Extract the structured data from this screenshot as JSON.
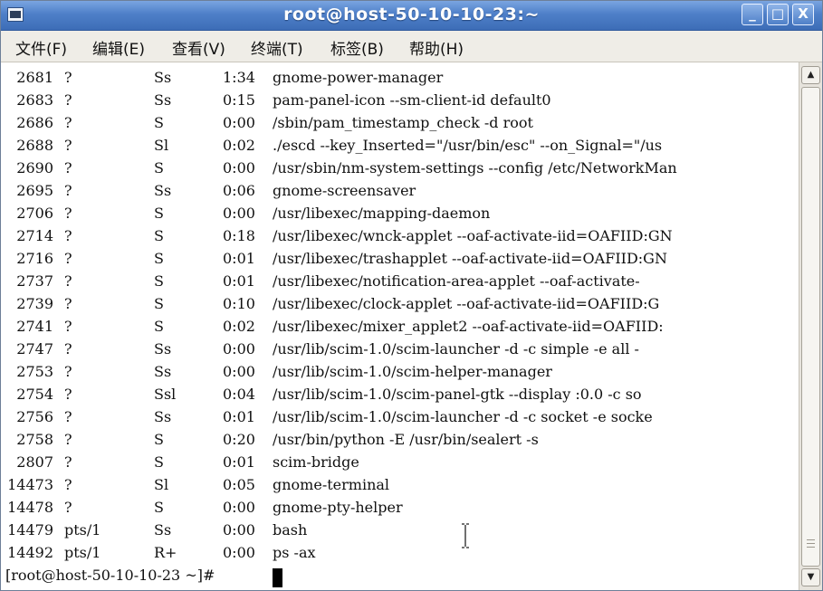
{
  "window": {
    "title": "root@host-50-10-10-23:~",
    "buttons": {
      "minimize": "_",
      "maximize": "□",
      "close": "X"
    }
  },
  "menu": [
    {
      "label": "文件(F)"
    },
    {
      "label": "编辑(E)"
    },
    {
      "label": "查看(V)"
    },
    {
      "label": "终端(T)"
    },
    {
      "label": "标签(B)"
    },
    {
      "label": "帮助(H)"
    }
  ],
  "processes": [
    {
      "pid": "2681",
      "tty": "?",
      "stat": "Ss",
      "time": "1:34",
      "cmd": "gnome-power-manager"
    },
    {
      "pid": "2683",
      "tty": "?",
      "stat": "Ss",
      "time": "0:15",
      "cmd": "pam-panel-icon --sm-client-id default0"
    },
    {
      "pid": "2686",
      "tty": "?",
      "stat": "S",
      "time": "0:00",
      "cmd": "/sbin/pam_timestamp_check -d root"
    },
    {
      "pid": "2688",
      "tty": "?",
      "stat": "Sl",
      "time": "0:02",
      "cmd": "./escd --key_Inserted=\"/usr/bin/esc\" --on_Signal=\"/us"
    },
    {
      "pid": "2690",
      "tty": "?",
      "stat": "S",
      "time": "0:00",
      "cmd": "/usr/sbin/nm-system-settings --config /etc/NetworkMan"
    },
    {
      "pid": "2695",
      "tty": "?",
      "stat": "Ss",
      "time": "0:06",
      "cmd": "gnome-screensaver"
    },
    {
      "pid": "2706",
      "tty": "?",
      "stat": "S",
      "time": "0:00",
      "cmd": "/usr/libexec/mapping-daemon"
    },
    {
      "pid": "2714",
      "tty": "?",
      "stat": "S",
      "time": "0:18",
      "cmd": "/usr/libexec/wnck-applet --oaf-activate-iid=OAFIID:GN"
    },
    {
      "pid": "2716",
      "tty": "?",
      "stat": "S",
      "time": "0:01",
      "cmd": "/usr/libexec/trashapplet --oaf-activate-iid=OAFIID:GN"
    },
    {
      "pid": "2737",
      "tty": "?",
      "stat": "S",
      "time": "0:01",
      "cmd": "/usr/libexec/notification-area-applet --oaf-activate-"
    },
    {
      "pid": "2739",
      "tty": "?",
      "stat": "S",
      "time": "0:10",
      "cmd": "/usr/libexec/clock-applet --oaf-activate-iid=OAFIID:G"
    },
    {
      "pid": "2741",
      "tty": "?",
      "stat": "S",
      "time": "0:02",
      "cmd": "/usr/libexec/mixer_applet2 --oaf-activate-iid=OAFIID:"
    },
    {
      "pid": "2747",
      "tty": "?",
      "stat": "Ss",
      "time": "0:00",
      "cmd": "/usr/lib/scim-1.0/scim-launcher -d -c simple -e all -"
    },
    {
      "pid": "2753",
      "tty": "?",
      "stat": "Ss",
      "time": "0:00",
      "cmd": "/usr/lib/scim-1.0/scim-helper-manager"
    },
    {
      "pid": "2754",
      "tty": "?",
      "stat": "Ssl",
      "time": "0:04",
      "cmd": "/usr/lib/scim-1.0/scim-panel-gtk --display :0.0 -c so"
    },
    {
      "pid": "2756",
      "tty": "?",
      "stat": "Ss",
      "time": "0:01",
      "cmd": "/usr/lib/scim-1.0/scim-launcher -d -c socket -e socke"
    },
    {
      "pid": "2758",
      "tty": "?",
      "stat": "S",
      "time": "0:20",
      "cmd": "/usr/bin/python -E /usr/bin/sealert -s"
    },
    {
      "pid": "2807",
      "tty": "?",
      "stat": "S",
      "time": "0:01",
      "cmd": "scim-bridge"
    },
    {
      "pid": "14473",
      "tty": "?",
      "stat": "Sl",
      "time": "0:05",
      "cmd": "gnome-terminal"
    },
    {
      "pid": "14478",
      "tty": "?",
      "stat": "S",
      "time": "0:00",
      "cmd": "gnome-pty-helper"
    },
    {
      "pid": "14479",
      "tty": "pts/1",
      "stat": "Ss",
      "time": "0:00",
      "cmd": "bash"
    },
    {
      "pid": "14492",
      "tty": "pts/1",
      "stat": "R+",
      "time": "0:00",
      "cmd": "ps -ax"
    }
  ],
  "prompt": "[root@host-50-10-10-23 ~]#",
  "scrollbar": {
    "up_arrow": "▲",
    "down_arrow": "▼",
    "position": 1.0
  }
}
